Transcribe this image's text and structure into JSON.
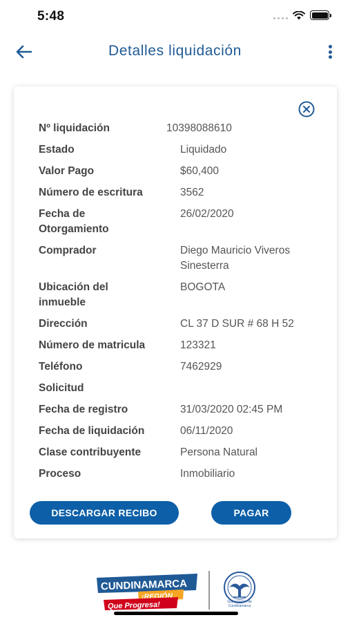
{
  "status_bar": {
    "time": "5:48"
  },
  "header": {
    "title": "Detalles liquidación"
  },
  "details": [
    {
      "label": "Nº liquidación",
      "value": "10398088610"
    },
    {
      "label": "Estado",
      "value": "Liquidado"
    },
    {
      "label": "Valor Pago",
      "value": "$60,400"
    },
    {
      "label": "Número de escritura",
      "value": "3562"
    },
    {
      "label": "Fecha de Otorgamiento",
      "value": "26/02/2020"
    },
    {
      "label": "Comprador",
      "value": "Diego Mauricio Viveros Sinesterra"
    },
    {
      "label": "Ubicación del inmueble",
      "value": "BOGOTA"
    },
    {
      "label": "Dirección",
      "value": "CL 37 D SUR # 68 H 52"
    },
    {
      "label": "Número de matricula",
      "value": "123321"
    },
    {
      "label": "Teléfono",
      "value": "7462929"
    },
    {
      "label": "Solicitud",
      "value": ""
    },
    {
      "label": "Fecha de registro",
      "value": "31/03/2020 02:45 PM"
    },
    {
      "label": "Fecha de liquidación",
      "value": "06/11/2020"
    },
    {
      "label": "Clase contribuyente",
      "value": "Persona Natural"
    },
    {
      "label": "Proceso",
      "value": "Inmobiliario"
    }
  ],
  "actions": {
    "download_label": "DESCARGAR RECIBO",
    "pay_label": "PAGAR"
  },
  "footer": {
    "logo_main": "CUNDINAMARCA",
    "logo_region": "¡REGIÓN",
    "logo_slogan": "Que Progresa!",
    "logo_gob": "Gobernación de Cundinamarca"
  },
  "colors": {
    "primary": "#1f5a96",
    "button": "#0d5fa8",
    "accent_orange": "#f5a623",
    "accent_red": "#d0021b"
  }
}
